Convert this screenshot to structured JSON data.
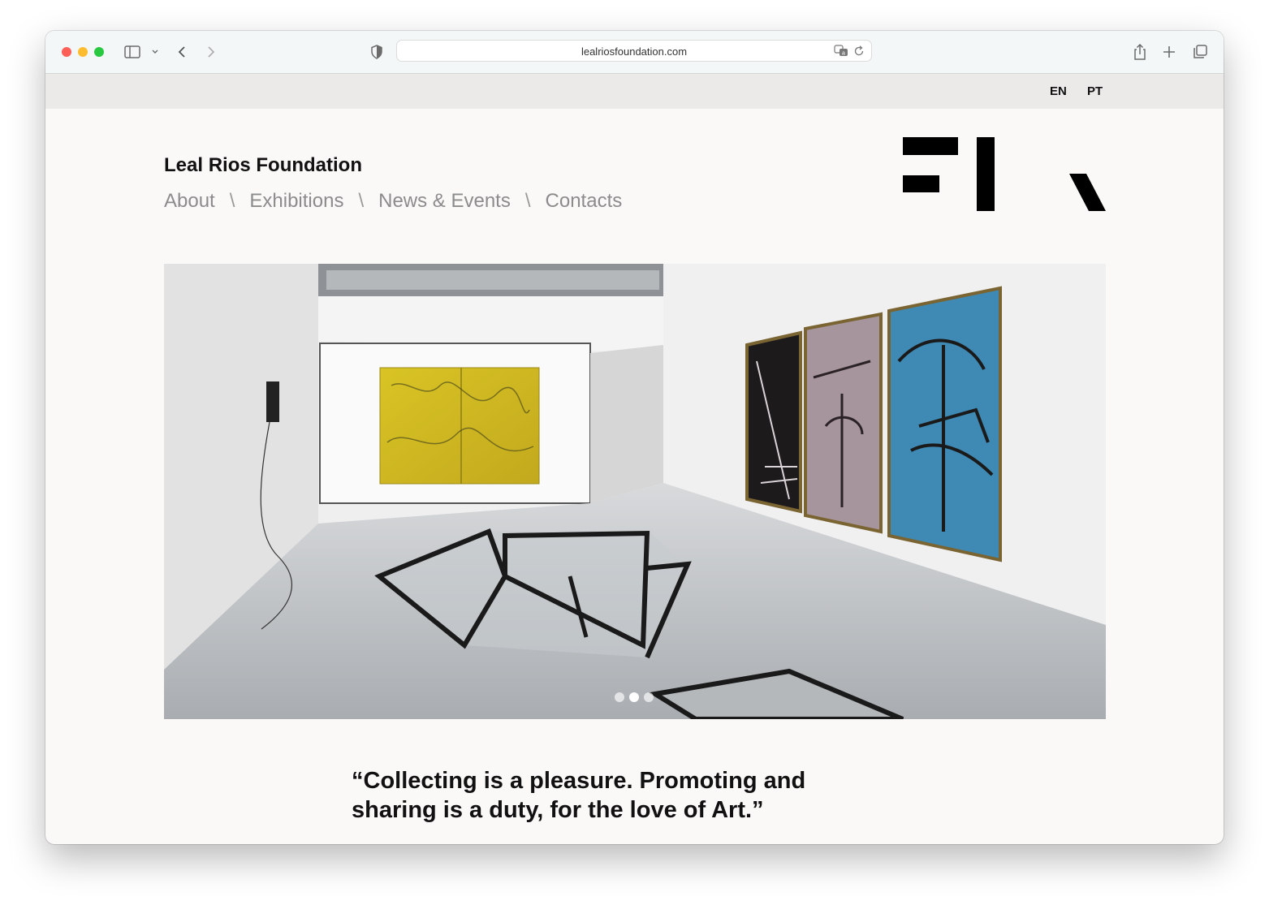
{
  "browser": {
    "url": "lealriosfoundation.com"
  },
  "lang": {
    "en": "EN",
    "pt": "PT"
  },
  "site": {
    "title": "Leal Rios Foundation",
    "nav": [
      "About",
      "Exhibitions",
      "News & Events",
      "Contacts"
    ],
    "separator": "\\"
  },
  "slideshow": {
    "slide_count": 3,
    "active_index": 1
  },
  "quote": {
    "line1": "“Collecting is a pleasure. Promoting and",
    "line2": "sharing is a duty, for the love of Art.”"
  },
  "colors": {
    "accent_text": "#111111",
    "nav_text": "#8c8c8c",
    "page_bg": "#faf9f8",
    "lang_bar": "#ebeae9"
  },
  "icons": [
    "sidebar-icon",
    "chevron-down-icon",
    "back-icon",
    "forward-icon",
    "shield-icon",
    "translate-icon",
    "reload-icon",
    "share-icon",
    "new-tab-icon",
    "tabs-overview-icon"
  ]
}
